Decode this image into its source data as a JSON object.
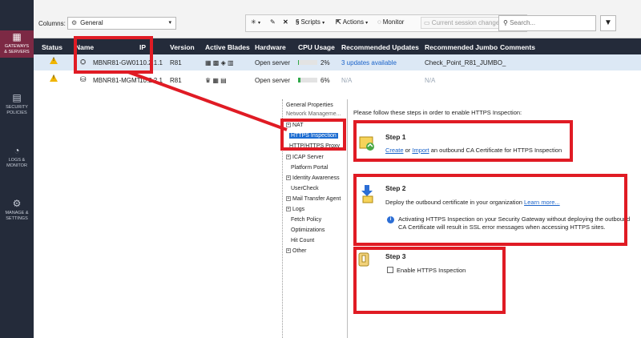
{
  "sidebar": {
    "items": [
      {
        "label": "GATEWAYS\n& SERVERS",
        "icon": "gateways-icon",
        "active": true
      },
      {
        "label": "SECURITY\nPOLICIES",
        "icon": "policies-icon"
      },
      {
        "label": "LOGS &\nMONITOR",
        "icon": "logs-icon"
      },
      {
        "label": "MANAGE &\nSETTINGS",
        "icon": "settings-icon"
      }
    ]
  },
  "toolbar": {
    "columns_label": "Columns:",
    "columns_value": "General",
    "scripts_label": "Scripts",
    "actions_label": "Actions",
    "monitor_label": "Monitor",
    "session_label": "Current session changes...",
    "search_placeholder": "Search..."
  },
  "table": {
    "headers": {
      "status": "Status",
      "name": "Name",
      "ip": "IP",
      "version": "Version",
      "blades": "Active Blades",
      "hardware": "Hardware",
      "cpu": "CPU Usage",
      "updates": "Recommended Updates",
      "jumbo": "Recommended Jumbo",
      "comments": "Comments"
    },
    "rows": [
      {
        "name": "MBNR81-GW01",
        "ip": "10.2.1.1",
        "version": "R81",
        "hardware": "Open server",
        "cpu": "2%",
        "cpu_fraction": 0.02,
        "updates": "3 updates available",
        "jumbo": "Check_Point_R81_JUMBO_"
      },
      {
        "name": "MBNR81-MGMT",
        "ip": "10.2.2.1",
        "version": "R81",
        "hardware": "Open server",
        "cpu": "6%",
        "cpu_fraction": 0.06,
        "updates": "N/A",
        "jumbo": "N/A"
      }
    ]
  },
  "tree": {
    "items": [
      {
        "label": "General Properties"
      },
      {
        "label": "Network Manageme..."
      },
      {
        "label": "NAT"
      },
      {
        "label": "HTTPS Inspection",
        "selected": true
      },
      {
        "label": "HTTP/HTTPS Proxy"
      },
      {
        "label": "ICAP Server"
      },
      {
        "label": "Platform Portal"
      },
      {
        "label": "Identity Awareness"
      },
      {
        "label": "UserCheck"
      },
      {
        "label": "Mail Transfer Agent"
      },
      {
        "label": "Logs"
      },
      {
        "label": "Fetch Policy"
      },
      {
        "label": "Optimizations"
      },
      {
        "label": "Hit Count"
      },
      {
        "label": "Other"
      }
    ]
  },
  "panel": {
    "intro": "Please follow these steps in order to enable HTTPS Inspection:",
    "step1": {
      "title": "Step 1",
      "create": "Create",
      "or": "or",
      "import": "Import",
      "rest": "an outbound CA Certificate for HTTPS Inspection"
    },
    "step2": {
      "title": "Step 2",
      "text": "Deploy the outbound certificate in your organization",
      "learn_more": "Learn more...",
      "info_line1": "Activating HTTPS Inspection on your Security Gateway without deploying the outbound",
      "info_line2": "CA Certificate will result in SSL error messages when accessing HTTPS sites."
    },
    "step3": {
      "title": "Step 3",
      "checkbox_label": "Enable HTTPS Inspection"
    }
  },
  "colors": {
    "sidebar_bg": "#242b3a",
    "active_nav": "#7c2944",
    "annotation_red": "#e01b24",
    "link_blue": "#1b63c9"
  }
}
